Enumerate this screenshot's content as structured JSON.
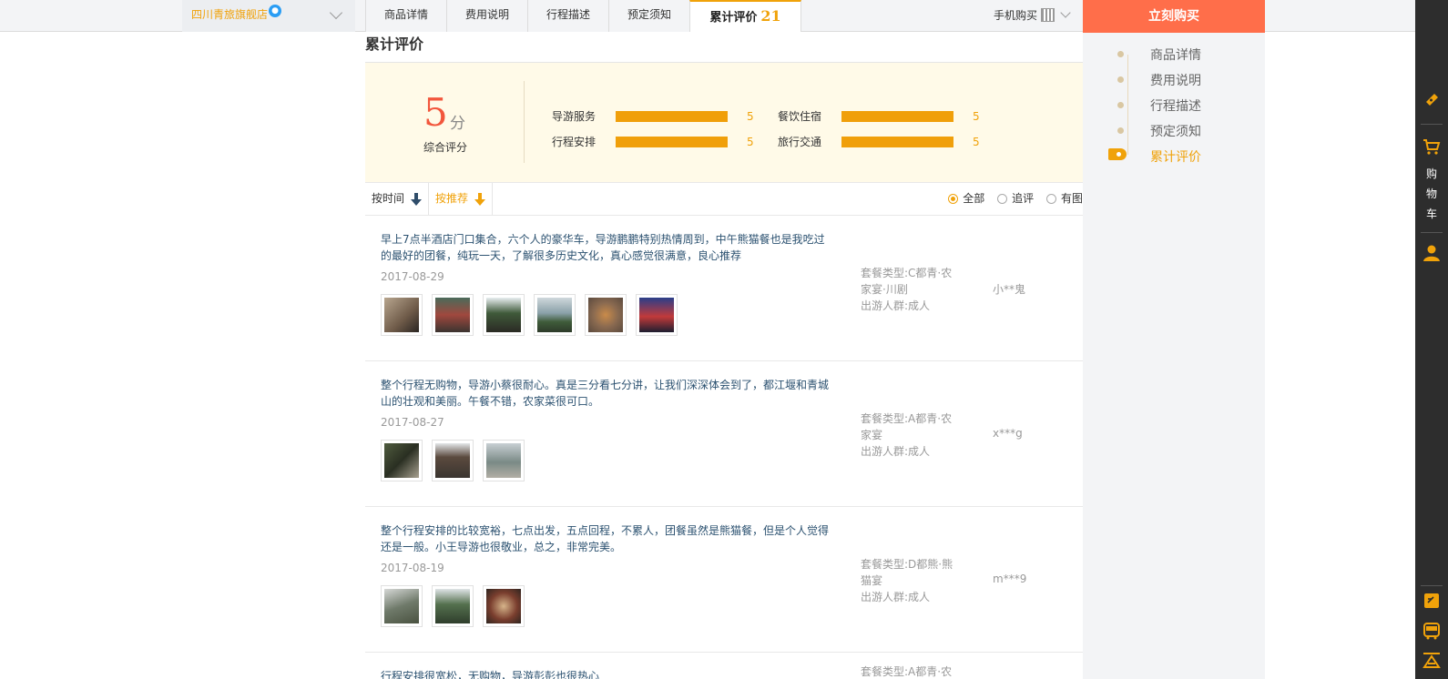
{
  "topbar": {
    "store_name": "四川青旅旗舰店",
    "tabs": [
      {
        "label": "商品详情"
      },
      {
        "label": "费用说明"
      },
      {
        "label": "行程描述"
      },
      {
        "label": "预定须知"
      },
      {
        "label": "累计评价",
        "count": "21"
      }
    ],
    "mobile_buy": "手机购买",
    "buy_now": "立刻购买"
  },
  "side_nav": {
    "items": [
      "商品详情",
      "费用说明",
      "行程描述",
      "预定须知",
      "累计评价"
    ],
    "active_index": 4
  },
  "rail": {
    "cart_chars": [
      "购",
      "物",
      "车"
    ],
    "icons": [
      "coupon-icon",
      "cart-icon",
      "user-icon",
      "note-icon",
      "bus-icon",
      "top-icon"
    ]
  },
  "reviews_section": {
    "title": "累计评价",
    "overall_score": "5",
    "score_unit": "分",
    "score_label": "综合评分",
    "ratings": [
      {
        "label": "导游服务",
        "value": "5",
        "fraction": 1.0
      },
      {
        "label": "餐饮住宿",
        "value": "5",
        "fraction": 1.0
      },
      {
        "label": "行程安排",
        "value": "5",
        "fraction": 1.0
      },
      {
        "label": "旅行交通",
        "value": "5",
        "fraction": 1.0
      }
    ],
    "sort_time": "按时间",
    "sort_recommend": "按推荐",
    "filters": [
      {
        "label": "全部",
        "selected": true
      },
      {
        "label": "追评",
        "selected": false
      },
      {
        "label": "有图",
        "selected": false
      }
    ]
  },
  "reviews": [
    {
      "text": "早上7点半酒店门口集合，六个人的豪华车，导游鹏鹏特别热情周到，中午熊猫餐也是我吃过的最好的团餐，纯玩一天，了解很多历史文化，真心感觉很满意，良心推荐",
      "date": "2017-08-29",
      "photos": 6,
      "package_line1": "套餐类型:C都青·农",
      "package_line2": "家宴·川剧",
      "crowd": "出游人群:成人",
      "user": "小**鬼"
    },
    {
      "text": "整个行程无购物，导游小蔡很耐心。真是三分看七分讲，让我们深深体会到了，都江堰和青城山的壮观和美丽。午餐不错，农家菜很可口。",
      "date": "2017-08-27",
      "photos": 3,
      "package_line1": "套餐类型:A都青·农",
      "package_line2": "家宴",
      "crowd": "出游人群:成人",
      "user": "x***g"
    },
    {
      "text": "整个行程安排的比较宽裕，七点出发，五点回程，不累人，团餐虽然是熊猫餐，但是个人觉得还是一般。小王导游也很敬业，总之，非常完美。",
      "date": "2017-08-19",
      "photos": 3,
      "package_line1": "套餐类型:D都熊·熊",
      "package_line2": "猫宴",
      "crowd": "出游人群:成人",
      "user": "m***9"
    },
    {
      "text": "行程安排很宽松，无购物，导游彭彭也很热心",
      "package_line1": "套餐类型:A都青·农"
    }
  ]
}
